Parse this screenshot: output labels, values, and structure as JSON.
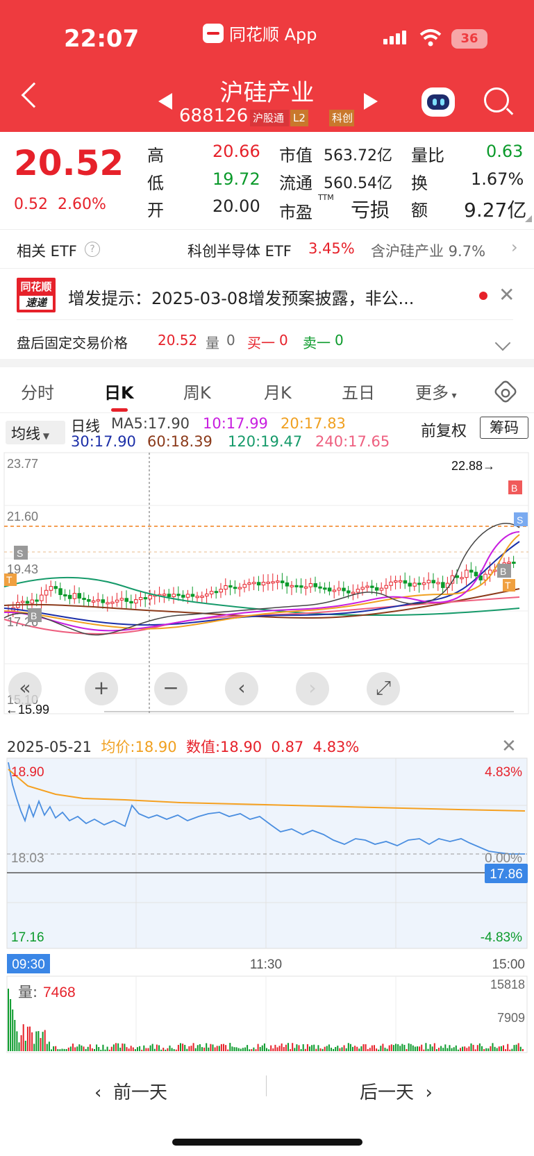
{
  "status": {
    "time": "22:07",
    "app": "同花顺 App",
    "battery": "36"
  },
  "header": {
    "name": "沪硅产业",
    "code": "688126",
    "tags": [
      "沪股通",
      "L2",
      "科创"
    ]
  },
  "quote": {
    "price": "20.52",
    "change": "0.52",
    "change_pct": "2.60%",
    "high_label": "高",
    "high": "20.66",
    "low_label": "低",
    "low": "19.72",
    "open_label": "开",
    "open": "20.00",
    "mcap_label": "市值",
    "mcap": "563.72亿",
    "float_label": "流通",
    "float": "560.54亿",
    "pe_label": "市盈",
    "pe_sup": "TTM",
    "pe": "亏损",
    "vr_label": "量比",
    "vr": "0.63",
    "turn_label": "换",
    "turn": "1.67%",
    "amt_label": "额",
    "amt": "9.27亿"
  },
  "etf": {
    "label": "相关 ETF",
    "name": "科创半导体 ETF",
    "pct": "3.45%",
    "hold": "含沪硅产业 9.7%"
  },
  "news": {
    "logo_top": "同花顺",
    "logo_bottom": "速递",
    "text": "增发提示：2025-03-08增发预案披露，非公..."
  },
  "after_hours": {
    "label": "盘后固定交易价格",
    "price": "20.52",
    "vol_label": "量",
    "vol": "0",
    "buy_label": "买一",
    "buy": "0",
    "sell_label": "卖一",
    "sell": "0"
  },
  "tabs": [
    "分时",
    "日K",
    "周K",
    "月K",
    "五日",
    "更多"
  ],
  "ma_legend": {
    "button": "均线",
    "kind": "日线",
    "ma5": "MA5:17.90",
    "ma10": "10:17.99",
    "ma20": "20:17.83",
    "ma30": "30:17.90",
    "ma60": "60:18.39",
    "ma120": "120:19.47",
    "ma240": "240:17.65",
    "adjust": "前复权",
    "chips": "筹码"
  },
  "kline": {
    "y_labels": [
      "23.77",
      "21.60",
      "19.43",
      "17.26",
      "15.10"
    ],
    "high_mark": "22.88→",
    "low_mark": "←15.99",
    "colors": {
      "up": "#e6212a",
      "down": "#0b9a2b"
    }
  },
  "intraday": {
    "date": "2025-05-21",
    "avg_label": "均价:",
    "avg": "18.90",
    "val_label": "数值:",
    "val": "18.90",
    "chg": "0.87",
    "pct": "4.83%",
    "y_left": [
      "18.90",
      "18.03",
      "17.16"
    ],
    "y_right": [
      "4.83%",
      "0.00%",
      "-4.83%"
    ],
    "cursor": "17.86",
    "times": [
      "09:30",
      "11:30",
      "15:00"
    ],
    "vol_label": "量:",
    "vol": "7468",
    "vol_ticks": [
      "15818",
      "7909"
    ]
  },
  "footer": {
    "prev": "前一天",
    "next": "后一天"
  }
}
